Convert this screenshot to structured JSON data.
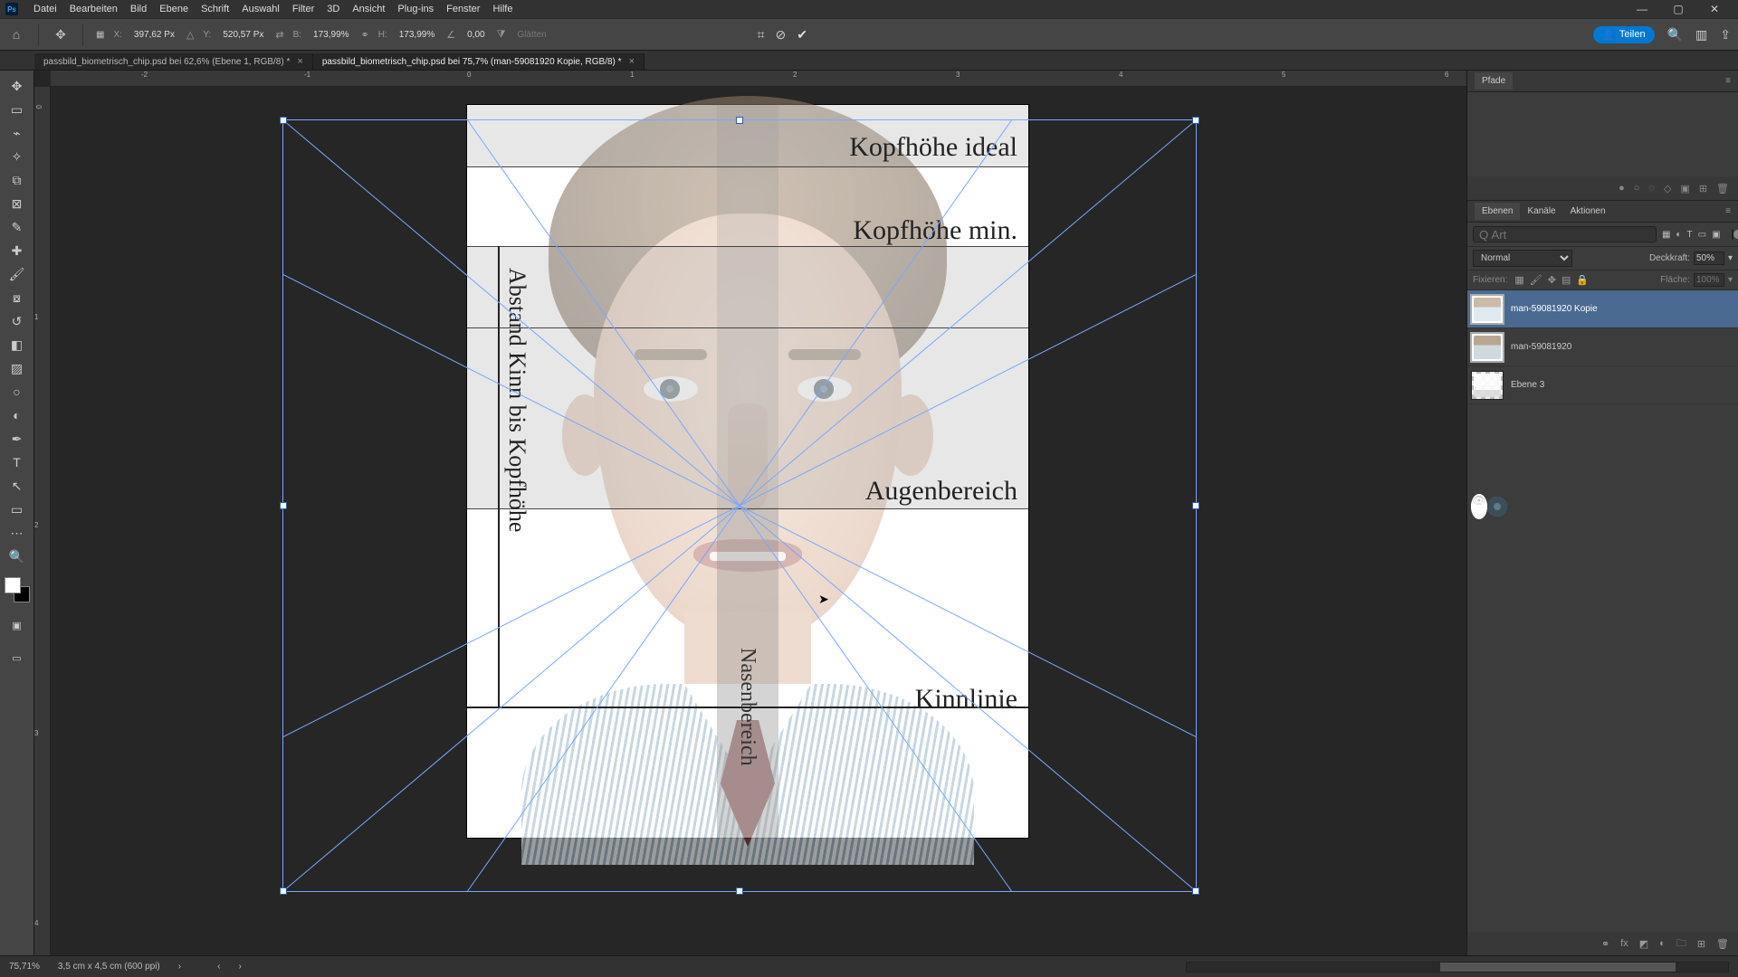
{
  "menu": [
    "Datei",
    "Bearbeiten",
    "Bild",
    "Ebene",
    "Schrift",
    "Auswahl",
    "Filter",
    "3D",
    "Ansicht",
    "Plug-ins",
    "Fenster",
    "Hilfe"
  ],
  "options": {
    "x_label": "X:",
    "x": "397,62 Px",
    "y_label": "Y:",
    "y": "520,57 Px",
    "w_label": "B:",
    "w": "173,99%",
    "h_label": "H:",
    "h": "173,99%",
    "angle": "0,00",
    "glatten": "Glätten",
    "teilen": "Teilen"
  },
  "tabs": [
    {
      "label": "passbild_biometrisch_chip.psd bei 62,6% (Ebene 1, RGB/8) *",
      "active": false
    },
    {
      "label": "passbild_biometrisch_chip.psd bei 75,7% (man-59081920 Kopie, RGB/8) *",
      "active": true
    }
  ],
  "canvas_labels": {
    "kopf_ideal": "Kopfhöhe ideal",
    "kopf_min": "Kopfhöhe min.",
    "augen": "Augenbereich",
    "kinn": "Kinnlinie",
    "abstand": "Abstand Kinn bis Kopfhöhe",
    "nase": "Nasenbereich"
  },
  "ruler_h": [
    "-2",
    "-1",
    "0",
    "1",
    "2",
    "3",
    "4",
    "5",
    "6"
  ],
  "ruler_v": [
    "0",
    "1",
    "2",
    "3",
    "4"
  ],
  "panels": {
    "pfade": "Pfade",
    "ebenen_tabs": [
      "Ebenen",
      "Kanäle",
      "Aktionen"
    ],
    "art_placeholder": "Q Art",
    "blend": "Normal",
    "deckkraft_label": "Deckkraft:",
    "deckkraft": "50%",
    "fixieren": "Fixieren:",
    "flache_label": "Fläche:",
    "flache": "100%",
    "layers": [
      {
        "name": "man-59081920 Kopie",
        "visible": true,
        "selected": true,
        "smart": true
      },
      {
        "name": "man-59081920",
        "visible": false,
        "selected": false,
        "smart": true
      },
      {
        "name": "Ebene 3",
        "visible": true,
        "selected": false,
        "smart": false
      }
    ]
  },
  "status": {
    "zoom": "75,71%",
    "doc": "3,5 cm x 4,5 cm (600 ppi)"
  }
}
